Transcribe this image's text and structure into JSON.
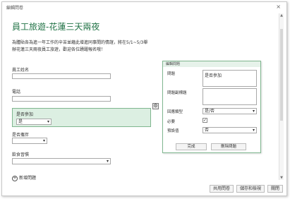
{
  "window": {
    "title": "編輯問卷",
    "close_icon": "×"
  },
  "page": {
    "title": "員工旅遊-花蓮三天兩夜",
    "description": "為體貼各為進一年工作的辛苦並藉此增進同事間的情誼，將在5/1~5/3舉辦花蓮三天兩夜員工旅遊，歡迎各位踴躍報名哦！"
  },
  "fields": {
    "employee_name": {
      "label": "員工姓名",
      "value": ""
    },
    "phone": {
      "label": "電話",
      "value": ""
    },
    "attend": {
      "label": "是否參加",
      "value": "是"
    },
    "family": {
      "label": "是否攜伴",
      "value": ""
    },
    "diet": {
      "label": "飲食習慣",
      "value": ""
    }
  },
  "add_question": "新增問題",
  "editor": {
    "header": "編輯問題",
    "question_label": "問題",
    "question_value": "是否參加",
    "subtitle_label": "問題副標題",
    "subtitle_value": "",
    "type_label": "回應類型",
    "type_value": "是/否",
    "required_label": "必要",
    "required_check": "✓",
    "default_label": "預設值",
    "default_value": "否",
    "done_button": "完成",
    "delete_button": "刪除問題"
  },
  "footer": {
    "share_button": "共用問卷",
    "save_button": "儲存和檢視",
    "close_button": "關閉"
  },
  "colors": {
    "accent": "#217346",
    "highlight": "#dcefe2"
  }
}
